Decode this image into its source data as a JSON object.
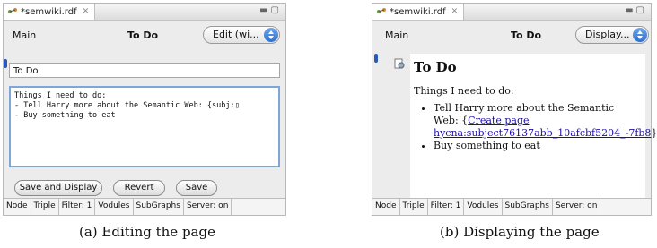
{
  "editing": {
    "tab_title": "*semwiki.rdf",
    "main_label": "Main",
    "page_title": "To Do",
    "mode_select": "Edit (wi...",
    "title_field_value": "To Do",
    "editor_text": "Things I need to do:\n- Tell Harry more about the Semantic Web: {subj:▯\n- Buy something to eat",
    "buttons": {
      "save_display": "Save and Display",
      "revert": "Revert",
      "save": "Save"
    },
    "bottom_tabs": [
      "Node",
      "Triple",
      "Filter: 1",
      "Vodules",
      "SubGraphs",
      "Server: on"
    ],
    "caption": "(a) Editing the page"
  },
  "displaying": {
    "tab_title": "*semwiki.rdf",
    "main_label": "Main",
    "page_title": "To Do",
    "mode_select": "Display...",
    "heading": "To Do",
    "intro": "Things I need to do:",
    "item1_text": "Tell Harry more about the Semantic Web:",
    "item1_open_brace": "{",
    "item1_link": "Create page hycna:subject76137abb_10afcbf5204_-7fb8",
    "item1_close_brace": "}",
    "item2_text": "Buy something to eat",
    "bottom_tabs": [
      "Node",
      "Triple",
      "Filter: 1",
      "Vodules",
      "SubGraphs",
      "Server: on"
    ],
    "caption": "(b) Displaying the page"
  },
  "colors": {
    "accent_blue": "#2f6fd0",
    "link": "#1a0dab",
    "panel_bg": "#ececec"
  }
}
